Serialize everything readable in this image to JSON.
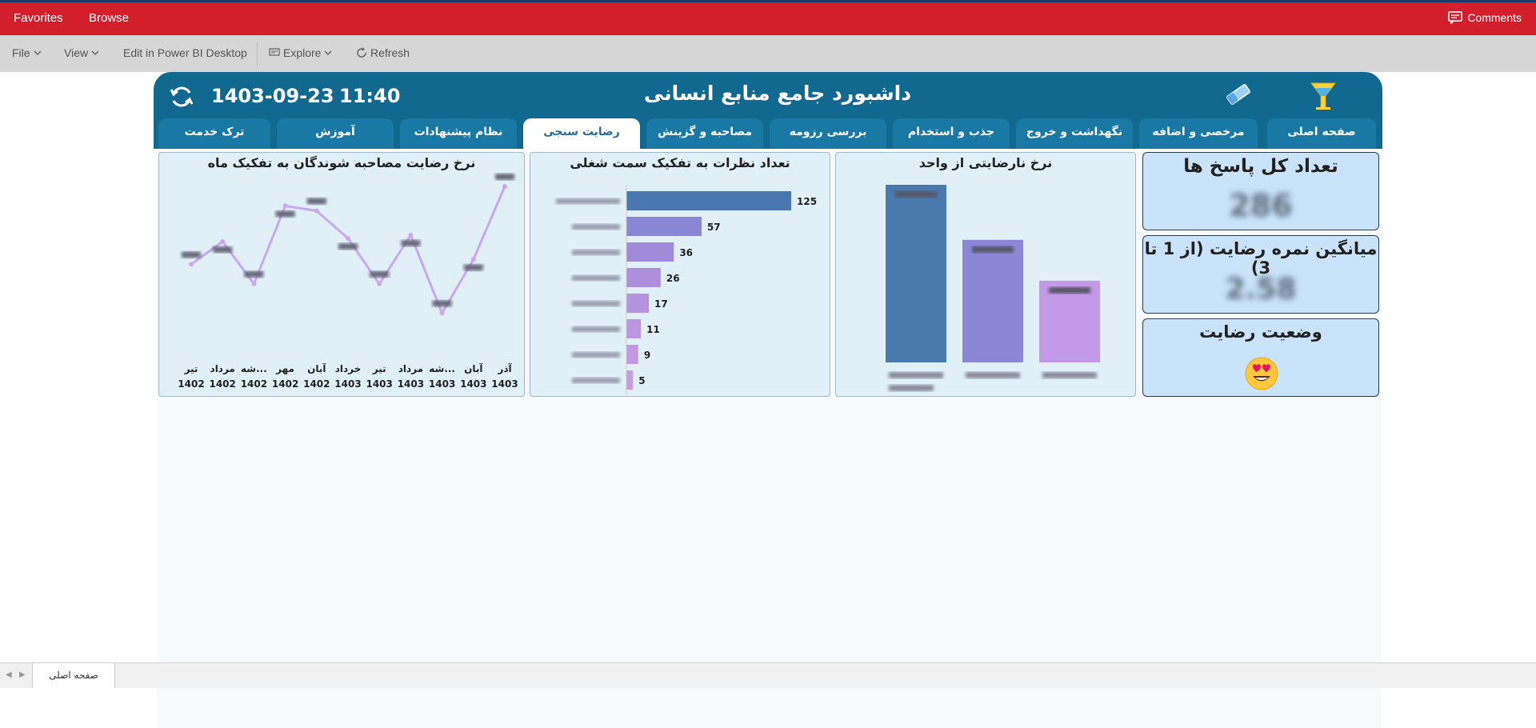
{
  "topbar": {
    "favorites": "Favorites",
    "browse": "Browse",
    "comments": "Comments"
  },
  "toolbar": {
    "file": "File",
    "view": "View",
    "edit_desktop": "Edit in Power BI Desktop",
    "explore": "Explore",
    "refresh": "Refresh"
  },
  "report": {
    "title": "داشبورد جامع منابع انسانی",
    "date": "1403-09-23",
    "time": "11:40",
    "tabs": [
      {
        "label": "صفحه اصلی"
      },
      {
        "label": "مرخصی و اضافه کاری"
      },
      {
        "label": "نگهداشت و خروج"
      },
      {
        "label": "جذب و استخدام"
      },
      {
        "label": "بررسی رزومه"
      },
      {
        "label": "مصاحبه و گزینش"
      },
      {
        "label": "رضایت سنجی"
      },
      {
        "label": "نظام پیشنهادات"
      },
      {
        "label": "آموزش"
      },
      {
        "label": "ترک خدمت"
      }
    ],
    "active_tab": "رضایت سنجی"
  },
  "cards": {
    "total_responses": {
      "title": "تعداد کل پاسخ ها",
      "value": "286"
    },
    "avg_score": {
      "title": "میانگین نمره رضایت (از 1 تا 3)",
      "value": "2.58"
    },
    "status": {
      "title": "وضعیت رضایت",
      "emoji": "heart-eyes-emoji"
    }
  },
  "chart_data": [
    {
      "type": "bar",
      "title": "نرخ نارضایتی از واحد",
      "categories": [
        "",
        "",
        ""
      ],
      "values": [
        100,
        69,
        46
      ],
      "colors": [
        "#4a7aad",
        "#8b87d6",
        "#c39ae8"
      ],
      "note": "values and category labels are blurred in the screenshot"
    },
    {
      "type": "bar",
      "orientation": "horizontal",
      "title": "تعداد نظرات به تفکیک سمت شغلی",
      "categories": [
        "",
        "",
        "",
        "",
        "",
        "",
        "",
        ""
      ],
      "values": [
        125,
        57,
        36,
        26,
        17,
        11,
        9,
        5
      ],
      "colors": [
        "#4a77ad",
        "#8a86d6",
        "#a08ad9",
        "#ad8fdc",
        "#b693de",
        "#bc96e0",
        "#c199e2",
        "#c69ce4"
      ]
    },
    {
      "type": "line",
      "title": "نرخ رضایت مصاحبه شوندگان به تفکیک ماه",
      "categories": [
        {
          "month": "آذر",
          "year": "1403"
        },
        {
          "month": "آبان",
          "year": "1403"
        },
        {
          "month": "...شه",
          "year": "1403"
        },
        {
          "month": "مرداد",
          "year": "1403"
        },
        {
          "month": "تیر",
          "year": "1403"
        },
        {
          "month": "خرداد",
          "year": "1403"
        },
        {
          "month": "آبان",
          "year": "1402"
        },
        {
          "month": "مهر",
          "year": "1402"
        },
        {
          "month": "...شه",
          "year": "1402"
        },
        {
          "month": "مرداد",
          "year": "1402"
        },
        {
          "month": "تیر",
          "year": "1402"
        }
      ],
      "values": [
        100,
        55,
        22,
        70,
        40,
        68,
        85,
        88,
        40,
        66,
        52
      ],
      "color": "#c9a8ee"
    }
  ],
  "statusbar": {
    "page_tab": "صفحه اصلی"
  }
}
